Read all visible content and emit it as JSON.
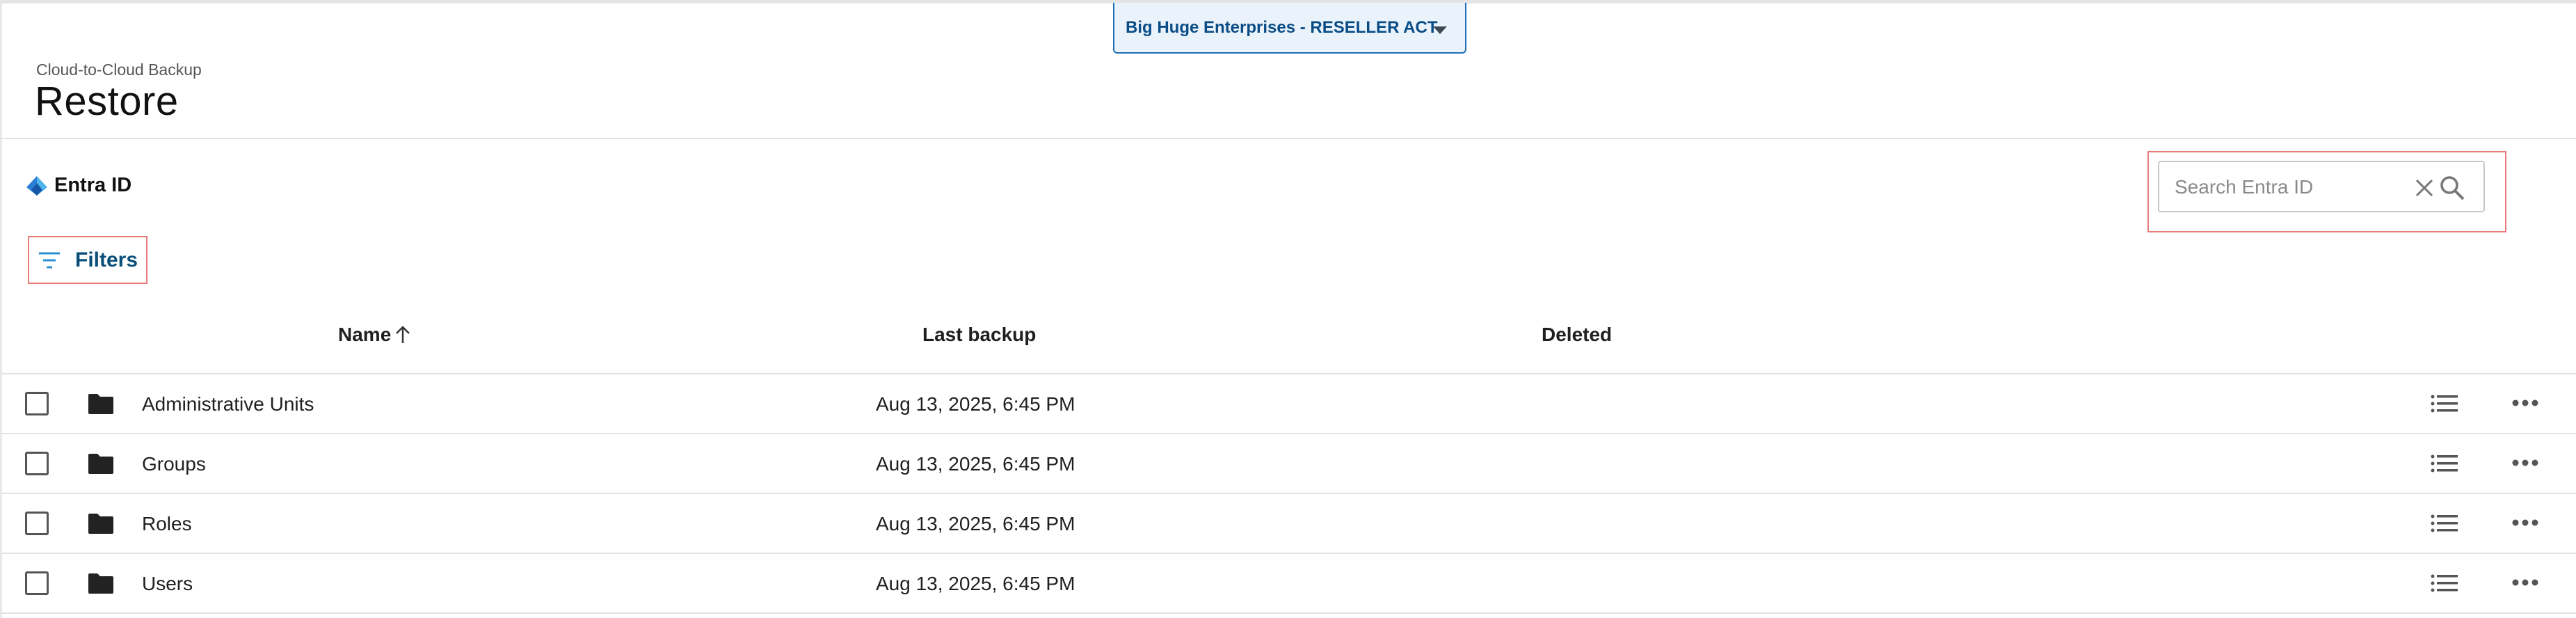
{
  "account_selector": {
    "label": "Big Huge Enterprises - RESELLER ACT"
  },
  "header": {
    "breadcrumb": "Cloud-to-Cloud Backup",
    "title": "Restore"
  },
  "service": {
    "label": "Entra ID",
    "icon": "entra-id-icon"
  },
  "search": {
    "placeholder": "Search Entra ID",
    "value": ""
  },
  "filters": {
    "label": "Filters"
  },
  "table": {
    "columns": {
      "name": "Name",
      "last_backup": "Last backup",
      "deleted": "Deleted"
    },
    "rows": [
      {
        "name": "Administrative Units",
        "last_backup": "Aug 13, 2025, 6:45 PM",
        "deleted": ""
      },
      {
        "name": "Groups",
        "last_backup": "Aug 13, 2025, 6:45 PM",
        "deleted": ""
      },
      {
        "name": "Roles",
        "last_backup": "Aug 13, 2025, 6:45 PM",
        "deleted": ""
      },
      {
        "name": "Users",
        "last_backup": "Aug 13, 2025, 6:45 PM",
        "deleted": ""
      }
    ]
  },
  "colors": {
    "accent": "#1e6fb3",
    "link": "#0a4f7a",
    "highlight": "#e97b7b"
  }
}
